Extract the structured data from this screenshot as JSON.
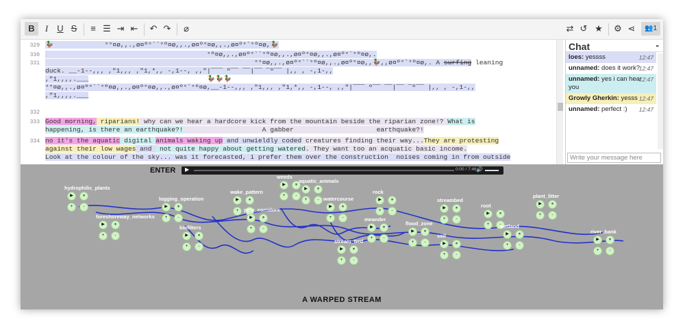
{
  "toolbar": {
    "buttons": [
      {
        "name": "bold-button",
        "glyph": "B"
      },
      {
        "name": "italic-button",
        "glyph": "I"
      },
      {
        "name": "underline-button",
        "glyph": "U"
      },
      {
        "name": "strikethrough-button",
        "glyph": "S"
      },
      {
        "name": "ordered-list-button",
        "glyph": "≡"
      },
      {
        "name": "bullet-list-button",
        "glyph": "☰"
      },
      {
        "name": "indent-button",
        "glyph": "⇥"
      },
      {
        "name": "outdent-button",
        "glyph": "⇤"
      },
      {
        "name": "undo-button",
        "glyph": "↶"
      },
      {
        "name": "redo-button",
        "glyph": "↷"
      },
      {
        "name": "hide-authorship-button",
        "glyph": "⌀"
      }
    ],
    "right": [
      {
        "name": "import-export-button",
        "glyph": "⇄"
      },
      {
        "name": "timeslider-button",
        "glyph": "↺"
      },
      {
        "name": "star-button",
        "glyph": "★"
      },
      {
        "name": "settings-button",
        "glyph": "⚙"
      },
      {
        "name": "share-button",
        "glyph": "⋖"
      }
    ],
    "users_count": "1"
  },
  "editor": {
    "lines": [
      {
        "n": "329",
        "segments": [
          {
            "t": "🦆",
            "c": "hl-b"
          },
          {
            "t": "             °°¤ø,,.,ø¤º°``°º¤ø,,.,ø¤º°¤ø,,.,ø¤º°`°º¤ø,🦆",
            "c": "hl-b"
          }
        ]
      },
      {
        "n": "330",
        "segments": [
          {
            "t": "                                         °º¤ø,,.,ø¤º°``°º¤ø,,.,ø¤º°¤ø,,.,ø¤º°`°º¤ø,.",
            "c": "hl-b"
          }
        ]
      },
      {
        "n": "331",
        "segments": [
          {
            "t": "                                                     °°¤ø,,.,ø¤º°``°º¤ø,,.,ø¤º°¤ø,,🦆,,ø¤º°`°º¤ø,. A ",
            "c": "hl-b"
          },
          {
            "t": "surfing",
            "c": "hl-b strike"
          },
          {
            "t": " leaning",
            "c": ""
          }
        ]
      },
      {
        "n": "",
        "segments": [
          {
            "t": "duck. __-1--,,, ,\"1,,, ,\"1,*,, -,1--, ,,\"|‾‾‾ º‾‾ ‾‾|‾‾ ‾º‾‾ |,, , -,1-,,",
            "c": "hl-b"
          }
        ]
      },
      {
        "n": "",
        "segments": [
          {
            "t": ",\"1,,,,.___",
            "c": "hl-b"
          },
          {
            "t": "                              🦆🦆🦆",
            "c": ""
          }
        ]
      },
      {
        "n": "",
        "segments": [
          {
            "t": "°°¤ø,,.,ø¤º°``°º¤ø,,.,ø¤º°¤ø,,.,ø¤º°`°º¤ø,__-1--,,, ,\"1,,, ,\"1,*,, -,1--, ,,\"|‾‾‾ º‾‾ ‾‾|‾‾ ‾º‾‾ |,, , -,1-,,",
            "c": "hl-b"
          }
        ]
      },
      {
        "n": "",
        "segments": [
          {
            "t": ",\"1,,,,.___",
            "c": "hl-b"
          }
        ]
      },
      {
        "n": "332",
        "segments": [
          {
            "t": "",
            "c": ""
          }
        ]
      },
      {
        "n": "333",
        "segments": [
          {
            "t": "Good morning,",
            "c": "hl-p"
          },
          {
            "t": " riparians!",
            "c": "hl-y"
          },
          {
            "t": " why can we hear a hardcore kick from the mountain beside the riparian zone!? ",
            "c": "hl-l"
          },
          {
            "t": "What is",
            "c": "hl-c"
          }
        ]
      },
      {
        "n": "",
        "segments": [
          {
            "t": "happening, is there an earthquake?!",
            "c": "hl-c"
          },
          {
            "t": "                    A ",
            "c": "hl-l"
          },
          {
            "t": "gabber",
            "c": "hl-l"
          },
          {
            "t": "                     earthquake?!",
            "c": "hl-l"
          }
        ]
      },
      {
        "n": "334",
        "segments": [
          {
            "t": "no it's the aquatic",
            "c": "hl-p"
          },
          {
            "t": " digital ",
            "c": "hl-c"
          },
          {
            "t": "animals waking up",
            "c": "hl-p"
          },
          {
            "t": " and unwieldly coded",
            "c": "hl-b"
          },
          {
            "t": " creatures finding their way...",
            "c": "hl-l"
          },
          {
            "t": "They are protesting",
            "c": "hl-y"
          }
        ]
      },
      {
        "n": "",
        "segments": [
          {
            "t": "against their low wages",
            "c": "hl-y"
          },
          {
            "t": " and ",
            "c": "hl-b"
          },
          {
            "t": " not quite happy about getting watered",
            "c": "hl-c"
          },
          {
            "t": ". They want too an acquatic basic income.",
            "c": "hl-l"
          }
        ]
      },
      {
        "n": "",
        "segments": [
          {
            "t": "Look at the colour of the sky... was it forecasted, i prefer them over the construction  noises coming in from outside",
            "c": "hl-b"
          }
        ]
      }
    ]
  },
  "chat": {
    "title": "Chat",
    "minimize": "-",
    "messages": [
      {
        "author": "loes:",
        "text": "yessss",
        "time": "12:47",
        "c": "hl-b"
      },
      {
        "author": "unnamed:",
        "text": "does it work?",
        "time": "12:47",
        "c": ""
      },
      {
        "author": "unnamed:",
        "text": "yes i can hear you",
        "time": "12:47",
        "c": "hl-c"
      },
      {
        "author": "Growly Gherkin:",
        "text": "yesss",
        "time": "12:47",
        "c": "hl-y"
      },
      {
        "author": "unnamed:",
        "text": "perfect :)",
        "time": "12:47",
        "c": ""
      }
    ],
    "input_placeholder": "Write your message here"
  },
  "player": {
    "enter_label": "ENTER",
    "audio_time": "0:00 / 7:46",
    "title": "A WARPED STREAM",
    "nodes": [
      {
        "label": "hydrophilic_plants"
      },
      {
        "label": "foreshoreway_networks"
      },
      {
        "label": "logging_operation"
      },
      {
        "label": "biofilters"
      },
      {
        "label": "wake_pattern"
      },
      {
        "label": "pine_corridors"
      },
      {
        "label": "weeds"
      },
      {
        "label": "aquatic_animals"
      },
      {
        "label": "watercourse"
      },
      {
        "label": "rock"
      },
      {
        "label": "meander"
      },
      {
        "label": "stream_bed"
      },
      {
        "label": "flood_zone"
      },
      {
        "label": "streambed"
      },
      {
        "label": "soil"
      },
      {
        "label": "root"
      },
      {
        "label": "wetland"
      },
      {
        "label": "plant_litter"
      },
      {
        "label": "river_bank"
      }
    ],
    "controls": {
      "play": "▶",
      "pause": "⏸",
      "plus": "+",
      "minus": "-"
    }
  },
  "colors": {
    "stage": "#a6a6a6",
    "stream": "#2231c7",
    "control": "#d3f2c8"
  }
}
